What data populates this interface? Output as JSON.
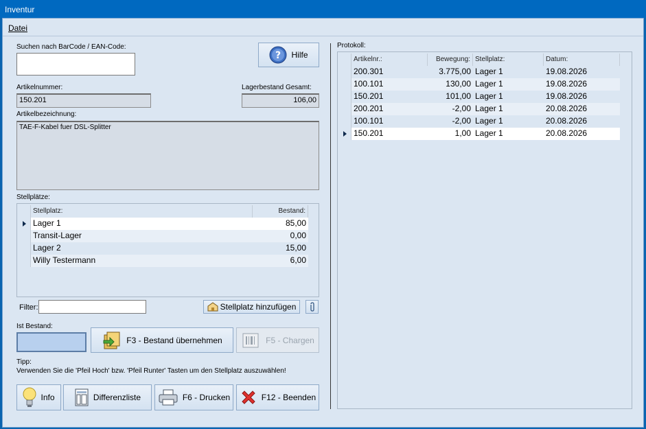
{
  "window": {
    "title": "Inventur"
  },
  "menu": {
    "items": [
      "Datei"
    ]
  },
  "search": {
    "label": "Suchen nach BarCode / EAN-Code:",
    "value": ""
  },
  "help_button": {
    "label": "Hilfe"
  },
  "article": {
    "number_label": "Artikelnummer:",
    "number": "150.201",
    "stock_label": "Lagerbestand Gesamt:",
    "stock": "106,00",
    "desc_label": "Artikelbezeichnung:",
    "desc": "TAE-F-Kabel fuer DSL-Splitter"
  },
  "locations": {
    "label": "Stellplätze:",
    "headers": {
      "place": "Stellplatz:",
      "stock": "Bestand:"
    },
    "rows": [
      {
        "place": "Lager 1",
        "stock": "85,00"
      },
      {
        "place": "Transit-Lager",
        "stock": "0,00"
      },
      {
        "place": "Lager 2",
        "stock": "15,00"
      },
      {
        "place": "Willy Testermann",
        "stock": "6,00"
      }
    ]
  },
  "filter": {
    "label": "Filter:",
    "value": ""
  },
  "add_location_button": {
    "label": "Stellplatz hinzufügen"
  },
  "actual_stock": {
    "label": "Ist Bestand:",
    "value": ""
  },
  "take_stock_button": {
    "label": "F3 - Bestand übernehmen"
  },
  "batches_button": {
    "label": "F5 - Chargen"
  },
  "tip": {
    "label": "Tipp:",
    "text": "Verwenden Sie die 'Pfeil Hoch' bzw. 'Pfeil Runter' Tasten um den Stellplatz auszuwählen!"
  },
  "bottom_buttons": {
    "info": "Info",
    "difflist": "Differenzliste",
    "print": "F6 - Drucken",
    "quit": "F12 - Beenden"
  },
  "protocol": {
    "label": "Protokoll:",
    "headers": {
      "article": "Artikelnr.:",
      "move": "Bewegung:",
      "place": "Stellplatz:",
      "date": "Datum:"
    },
    "rows": [
      {
        "article": "200.301",
        "move": "3.775,00",
        "place": "Lager 1",
        "date": "19.08.2026"
      },
      {
        "article": "100.101",
        "move": "130,00",
        "place": "Lager 1",
        "date": "19.08.2026"
      },
      {
        "article": "150.201",
        "move": "101,00",
        "place": "Lager 1",
        "date": "19.08.2026"
      },
      {
        "article": "200.201",
        "move": "-2,00",
        "place": "Lager 1",
        "date": "20.08.2026"
      },
      {
        "article": "100.101",
        "move": "-2,00",
        "place": "Lager 1",
        "date": "20.08.2026"
      },
      {
        "article": "150.201",
        "move": "1,00",
        "place": "Lager 1",
        "date": "20.08.2026"
      }
    ]
  },
  "colors": {
    "titlebar": "#0069c0",
    "background": "#dbe6f2",
    "accent": "#0e2a4d"
  }
}
